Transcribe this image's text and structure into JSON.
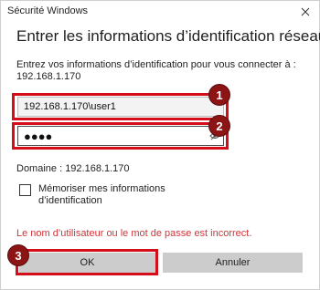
{
  "window": {
    "title": "Sécurité Windows",
    "close_icon": "close-icon"
  },
  "dialog": {
    "heading": "Entrer les informations d’identification réseau",
    "description": "Entrez vos informations d’identification pour vous connecter à : 192.168.1.170"
  },
  "fields": {
    "username_value": "192.168.1.170\\user1",
    "password_masked": "●●●●",
    "password_reveal_icon": "eye-icon"
  },
  "domain_text": "Domaine : 192.168.1.170",
  "remember": {
    "label": "Mémoriser mes informations d’identification",
    "checked": false
  },
  "error_text": "Le nom d’utilisateur ou le mot de passe est incorrect.",
  "buttons": {
    "ok_label": "OK",
    "cancel_label": "Annuler"
  },
  "annotations": {
    "badge_1": "1",
    "badge_2": "2",
    "badge_3": "3",
    "highlight_color": "#d50c1a",
    "badge_color": "#8c1414"
  },
  "colors": {
    "error": "#d13438",
    "button_bg": "#cccccc"
  }
}
